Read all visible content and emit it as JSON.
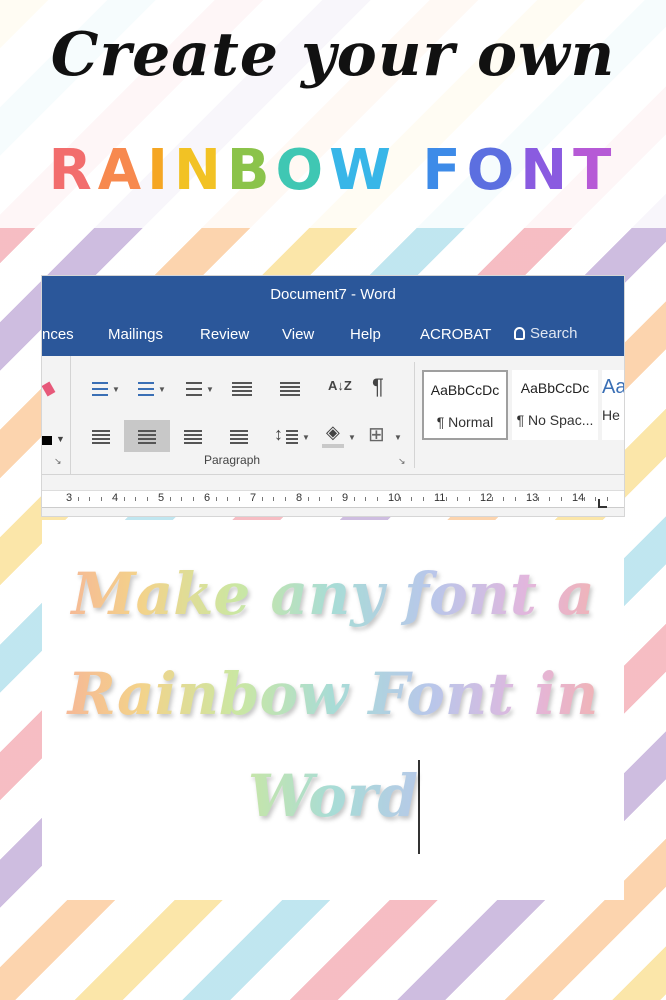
{
  "header": {
    "line1": "Create your own",
    "line2_letters": [
      {
        "ch": "R",
        "color": "#f26d6d"
      },
      {
        "ch": "A",
        "color": "#f7894e"
      },
      {
        "ch": "I",
        "color": "#f5a623"
      },
      {
        "ch": "N",
        "color": "#f2c224"
      },
      {
        "ch": "B",
        "color": "#8bc34a"
      },
      {
        "ch": "O",
        "color": "#3fc7b3"
      },
      {
        "ch": "W",
        "color": "#38b6e8"
      },
      {
        "ch": " ",
        "color": "#ffffff"
      },
      {
        "ch": "F",
        "color": "#3d8be8"
      },
      {
        "ch": "O",
        "color": "#5c6fe0"
      },
      {
        "ch": "N",
        "color": "#8a5be0"
      },
      {
        "ch": "T",
        "color": "#b65ad6"
      }
    ]
  },
  "word": {
    "window_title": "Document7  -  Word",
    "tabs": [
      "nces",
      "Mailings",
      "Review",
      "View",
      "Help",
      "ACROBAT"
    ],
    "search_label": "Search",
    "group_label": "Paragraph",
    "styles": [
      {
        "sample": "AaBbCcDc",
        "name": "¶ Normal"
      },
      {
        "sample": "AaBbCcDc",
        "name": "¶ No Spac..."
      },
      {
        "sample": "Aa",
        "name": "He"
      }
    ],
    "ruler_numbers": [
      "3",
      "4",
      "5",
      "6",
      "7",
      "8",
      "9",
      "10",
      "11",
      "12",
      "13",
      "14"
    ],
    "icons": {
      "sort": "A↓Z",
      "pilcrow": "¶",
      "border": "⊞",
      "fill": "◈"
    }
  },
  "document": {
    "lines": [
      "Make any font a",
      "Rainbow Font in",
      "Word"
    ]
  },
  "colors": {
    "ribbon_blue": "#2b579a",
    "selected_align": "#c8c8c8"
  }
}
